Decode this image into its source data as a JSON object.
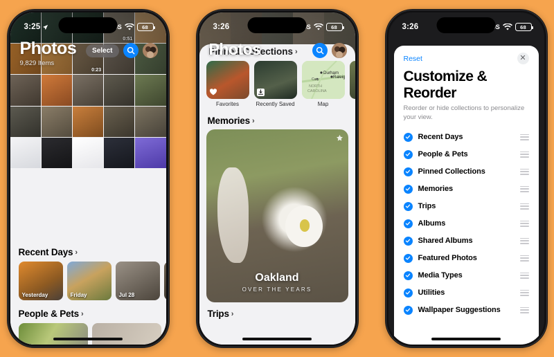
{
  "background_color": "#f6a44e",
  "accent_blue": "#0a84ff",
  "phone1": {
    "status": {
      "time": "3:25",
      "carrier": "SOS",
      "battery": "68",
      "wifi_icon": "wifi-icon",
      "location_icon": "location-arrow-icon"
    },
    "header": {
      "title": "Photos",
      "subtitle": "9,829 Items",
      "select_label": "Select",
      "search_icon": "search-icon",
      "avatar_icon": "avatar-icon"
    },
    "grid": {
      "video_durations": [
        "0:51",
        "0:23"
      ],
      "columns": 5
    },
    "sections": [
      {
        "title": "Recent Days",
        "chevron": "chevron-right-icon",
        "cards": [
          {
            "label": "Yesterday"
          },
          {
            "label": "Friday"
          },
          {
            "label": "Jul 28"
          },
          {
            "label": ""
          }
        ]
      },
      {
        "title": "People & Pets",
        "chevron": "chevron-right-icon",
        "cards": []
      }
    ]
  },
  "phone2": {
    "status": {
      "time": "3:26",
      "carrier": "SOS",
      "battery": "68",
      "wifi_icon": "wifi-icon"
    },
    "header": {
      "title": "Photos",
      "search_icon": "search-icon",
      "avatar_icon": "avatar-icon"
    },
    "pinned": {
      "title": "Pinned Collections",
      "chevron": "chevron-right-icon",
      "items": [
        {
          "label": "Favorites",
          "icon": "heart-icon"
        },
        {
          "label": "Recently Saved",
          "icon": "download-icon"
        },
        {
          "label": "Map",
          "icon": "map-icon",
          "places": [
            "Durham",
            "Raleigh",
            "Cary",
            "NORTH CAROLINA"
          ]
        }
      ]
    },
    "memories": {
      "title": "Memories",
      "chevron": "chevron-right-icon",
      "card": {
        "title": "Oakland",
        "subtitle": "OVER THE YEARS",
        "badge_icon": "memory-badge-icon"
      }
    },
    "trips": {
      "title": "Trips",
      "chevron": "chevron-right-icon"
    }
  },
  "phone3": {
    "status": {
      "time": "3:26",
      "carrier": "SOS",
      "battery": "68",
      "wifi_icon": "wifi-icon"
    },
    "sheet": {
      "reset_label": "Reset",
      "close_icon": "close-icon",
      "title": "Customize & Reorder",
      "subtitle": "Reorder or hide collections to personalize your view.",
      "items": [
        {
          "label": "Recent Days",
          "checked": true
        },
        {
          "label": "People & Pets",
          "checked": true
        },
        {
          "label": "Pinned Collections",
          "checked": true
        },
        {
          "label": "Memories",
          "checked": true
        },
        {
          "label": "Trips",
          "checked": true
        },
        {
          "label": "Albums",
          "checked": true
        },
        {
          "label": "Shared Albums",
          "checked": true
        },
        {
          "label": "Featured Photos",
          "checked": true
        },
        {
          "label": "Media Types",
          "checked": true
        },
        {
          "label": "Utilities",
          "checked": true
        },
        {
          "label": "Wallpaper Suggestions",
          "checked": true
        }
      ]
    }
  }
}
